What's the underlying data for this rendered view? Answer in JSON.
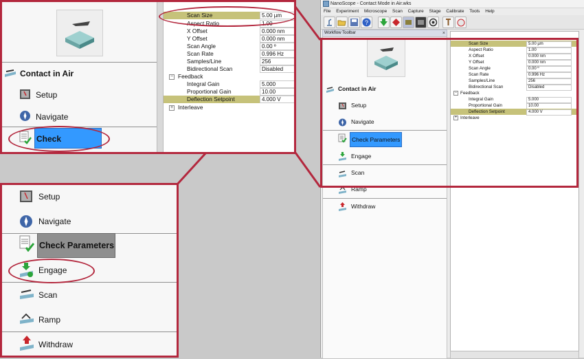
{
  "app": {
    "title": "NanoScope - Contact Mode in Air.wks",
    "menu": [
      "File",
      "Experiment",
      "Microscope",
      "Scan",
      "Capture",
      "Stage",
      "Calibrate",
      "Tools",
      "Help"
    ],
    "workflow_toolbar_title": "Workflow Toolbar",
    "close_glyph": "×"
  },
  "workflow": {
    "header": "Contact in Air",
    "items": {
      "setup": "Setup",
      "navigate": "Navigate",
      "check_parameters": "Check Parameters",
      "engage": "Engage",
      "scan": "Scan",
      "ramp": "Ramp",
      "withdraw": "Withdraw"
    }
  },
  "parameters": {
    "scan_size": {
      "label": "Scan Size",
      "value": "5.00 µm"
    },
    "aspect_ratio": {
      "label": "Aspect Ratio",
      "value": "1.00"
    },
    "x_offset": {
      "label": "X Offset",
      "value": "0.000 nm"
    },
    "y_offset": {
      "label": "Y Offset",
      "value": "0.000 nm"
    },
    "scan_angle": {
      "label": "Scan Angle",
      "value": "0.00 º"
    },
    "scan_rate": {
      "label": "Scan Rate",
      "value": "0.996 Hz"
    },
    "samples_line": {
      "label": "Samples/Line",
      "value": "256"
    },
    "bidirectional_scan": {
      "label": "Bidirectional Scan",
      "value": "Disabled"
    },
    "feedback": {
      "label": "Feedback"
    },
    "integral_gain": {
      "label": "Integral Gain",
      "value": "5.000"
    },
    "proportional_gain": {
      "label": "Proportional Gain",
      "value": "10.00"
    },
    "deflection_setpoint": {
      "label": "Deflection Setpoint",
      "value": "4.000 V"
    },
    "interleave": {
      "label": "Interleave"
    }
  },
  "tree": {
    "collapse": "−",
    "expand": "+"
  },
  "colors": {
    "highlight_red": "#b3273d",
    "selected_blue": "#3399ff",
    "row_highlight": "#c6c27a"
  }
}
